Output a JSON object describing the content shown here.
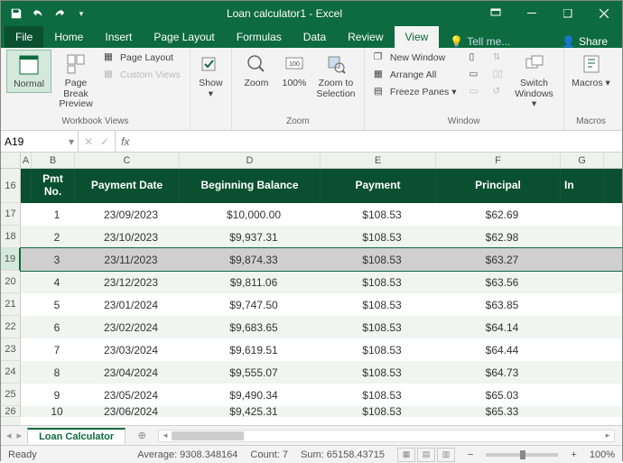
{
  "window_title": "Loan calculator1 - Excel",
  "tabs": {
    "file": "File",
    "home": "Home",
    "insert": "Insert",
    "page_layout": "Page Layout",
    "formulas": "Formulas",
    "data": "Data",
    "review": "Review",
    "view": "View",
    "tell_me": "Tell me...",
    "share": "Share"
  },
  "ribbon": {
    "workbook_views": {
      "label": "Workbook Views",
      "normal": "Normal",
      "page_break": "Page Break Preview",
      "page_layout": "Page Layout",
      "custom": "Custom Views"
    },
    "show_group": {
      "btn": "Show"
    },
    "zoom_group": {
      "label": "Zoom",
      "zoom": "Zoom",
      "hundred": "100%",
      "zoom_sel": "Zoom to Selection"
    },
    "window_group": {
      "label": "Window",
      "new": "New Window",
      "arrange": "Arrange All",
      "freeze": "Freeze Panes",
      "switch": "Switch Windows"
    },
    "macros_group": {
      "label": "Macros",
      "btn": "Macros"
    }
  },
  "namebox": "A19",
  "columns": [
    "A",
    "B",
    "C",
    "D",
    "E",
    "F",
    "G"
  ],
  "row_nums": [
    "16",
    "17",
    "18",
    "19",
    "20",
    "21",
    "22",
    "23",
    "24",
    "25",
    "26"
  ],
  "selected_row_index": 3,
  "headers": {
    "pmt_no": "Pmt No.",
    "payment_date": "Payment Date",
    "beg_bal": "Beginning Balance",
    "payment": "Payment",
    "principal": "Principal",
    "interest": "Interest"
  },
  "rows": [
    {
      "no": "1",
      "date": "23/09/2023",
      "bal": "$10,000.00",
      "pay": "$108.53",
      "prin": "$62.69"
    },
    {
      "no": "2",
      "date": "23/10/2023",
      "bal": "$9,937.31",
      "pay": "$108.53",
      "prin": "$62.98"
    },
    {
      "no": "3",
      "date": "23/11/2023",
      "bal": "$9,874.33",
      "pay": "$108.53",
      "prin": "$63.27"
    },
    {
      "no": "4",
      "date": "23/12/2023",
      "bal": "$9,811.06",
      "pay": "$108.53",
      "prin": "$63.56"
    },
    {
      "no": "5",
      "date": "23/01/2024",
      "bal": "$9,747.50",
      "pay": "$108.53",
      "prin": "$63.85"
    },
    {
      "no": "6",
      "date": "23/02/2024",
      "bal": "$9,683.65",
      "pay": "$108.53",
      "prin": "$64.14"
    },
    {
      "no": "7",
      "date": "23/03/2024",
      "bal": "$9,619.51",
      "pay": "$108.53",
      "prin": "$64.44"
    },
    {
      "no": "8",
      "date": "23/04/2024",
      "bal": "$9,555.07",
      "pay": "$108.53",
      "prin": "$64.73"
    },
    {
      "no": "9",
      "date": "23/05/2024",
      "bal": "$9,490.34",
      "pay": "$108.53",
      "prin": "$65.03"
    },
    {
      "no": "10",
      "date": "23/06/2024",
      "bal": "$9,425.31",
      "pay": "$108.53",
      "prin": "$65.33"
    }
  ],
  "sheet_tab": "Loan Calculator",
  "status": {
    "ready": "Ready",
    "avg": "Average: 9308.348164",
    "count": "Count: 7",
    "sum": "Sum: 65158.43715",
    "zoom": "100%"
  }
}
